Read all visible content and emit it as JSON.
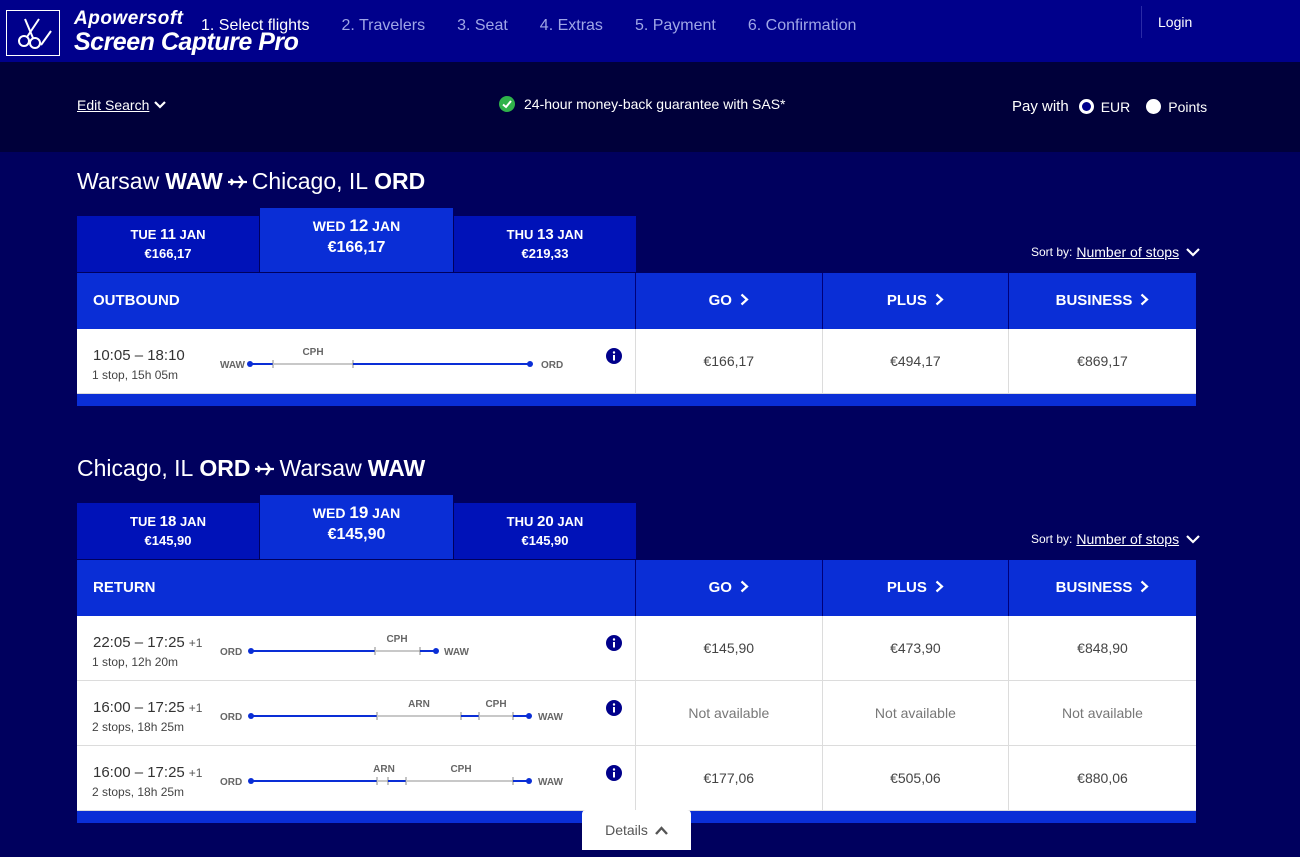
{
  "watermark": {
    "line1": "Apowersoft",
    "line2": "Screen Capture Pro"
  },
  "nav": {
    "steps": [
      "1. Select flights",
      "2. Travelers",
      "3. Seat",
      "4. Extras",
      "5. Payment",
      "6. Confirmation"
    ],
    "login": "Login"
  },
  "search": {
    "edit": "Edit Search",
    "guarantee": "24-hour money-back guarantee with SAS*",
    "pay_with": "Pay with",
    "options": [
      "EUR",
      "Points"
    ],
    "selected": "EUR"
  },
  "outbound": {
    "from_city": "Warsaw",
    "from_code": "WAW",
    "to_city": "Chicago, IL",
    "to_code": "ORD",
    "dates": [
      {
        "dow": "TUE",
        "day": "11",
        "mon": "JAN",
        "price": "€166,17"
      },
      {
        "dow": "WED",
        "day": "12",
        "mon": "JAN",
        "price": "€166,17"
      },
      {
        "dow": "THU",
        "day": "13",
        "mon": "JAN",
        "price": "€219,33"
      }
    ],
    "sort_label": "Sort by:",
    "sort_value": "Number of stops",
    "header": "OUTBOUND",
    "classes": [
      "GO",
      "PLUS",
      "BUSINESS"
    ],
    "flights": [
      {
        "times": "10:05 – 18:10",
        "plus": "",
        "stops": "1 stop, 15h 05m",
        "origin": "WAW",
        "dest": "ORD",
        "via": [
          "CPH"
        ],
        "prices": [
          "€166,17",
          "€494,17",
          "€869,17"
        ]
      }
    ]
  },
  "return": {
    "from_city": "Chicago, IL",
    "from_code": "ORD",
    "to_city": "Warsaw",
    "to_code": "WAW",
    "dates": [
      {
        "dow": "TUE",
        "day": "18",
        "mon": "JAN",
        "price": "€145,90"
      },
      {
        "dow": "WED",
        "day": "19",
        "mon": "JAN",
        "price": "€145,90"
      },
      {
        "dow": "THU",
        "day": "20",
        "mon": "JAN",
        "price": "€145,90"
      }
    ],
    "sort_label": "Sort by:",
    "sort_value": "Number of stops",
    "header": "RETURN",
    "classes": [
      "GO",
      "PLUS",
      "BUSINESS"
    ],
    "flights": [
      {
        "times": "22:05 – 17:25",
        "plus": "+1",
        "stops": "1 stop, 12h 20m",
        "origin": "ORD",
        "dest": "WAW",
        "via": [
          "CPH"
        ],
        "prices": [
          "€145,90",
          "€473,90",
          "€848,90"
        ]
      },
      {
        "times": "16:00 – 17:25",
        "plus": "+1",
        "stops": "2 stops, 18h 25m",
        "origin": "ORD",
        "dest": "WAW",
        "via": [
          "ARN",
          "CPH"
        ],
        "prices": [
          "Not available",
          "Not available",
          "Not available"
        ]
      },
      {
        "times": "16:00 – 17:25",
        "plus": "+1",
        "stops": "2 stops, 18h 25m",
        "origin": "ORD",
        "dest": "WAW",
        "via": [
          "ARN",
          "CPH"
        ],
        "prices": [
          "€177,06",
          "€505,06",
          "€880,06"
        ]
      }
    ]
  },
  "details": "Details"
}
